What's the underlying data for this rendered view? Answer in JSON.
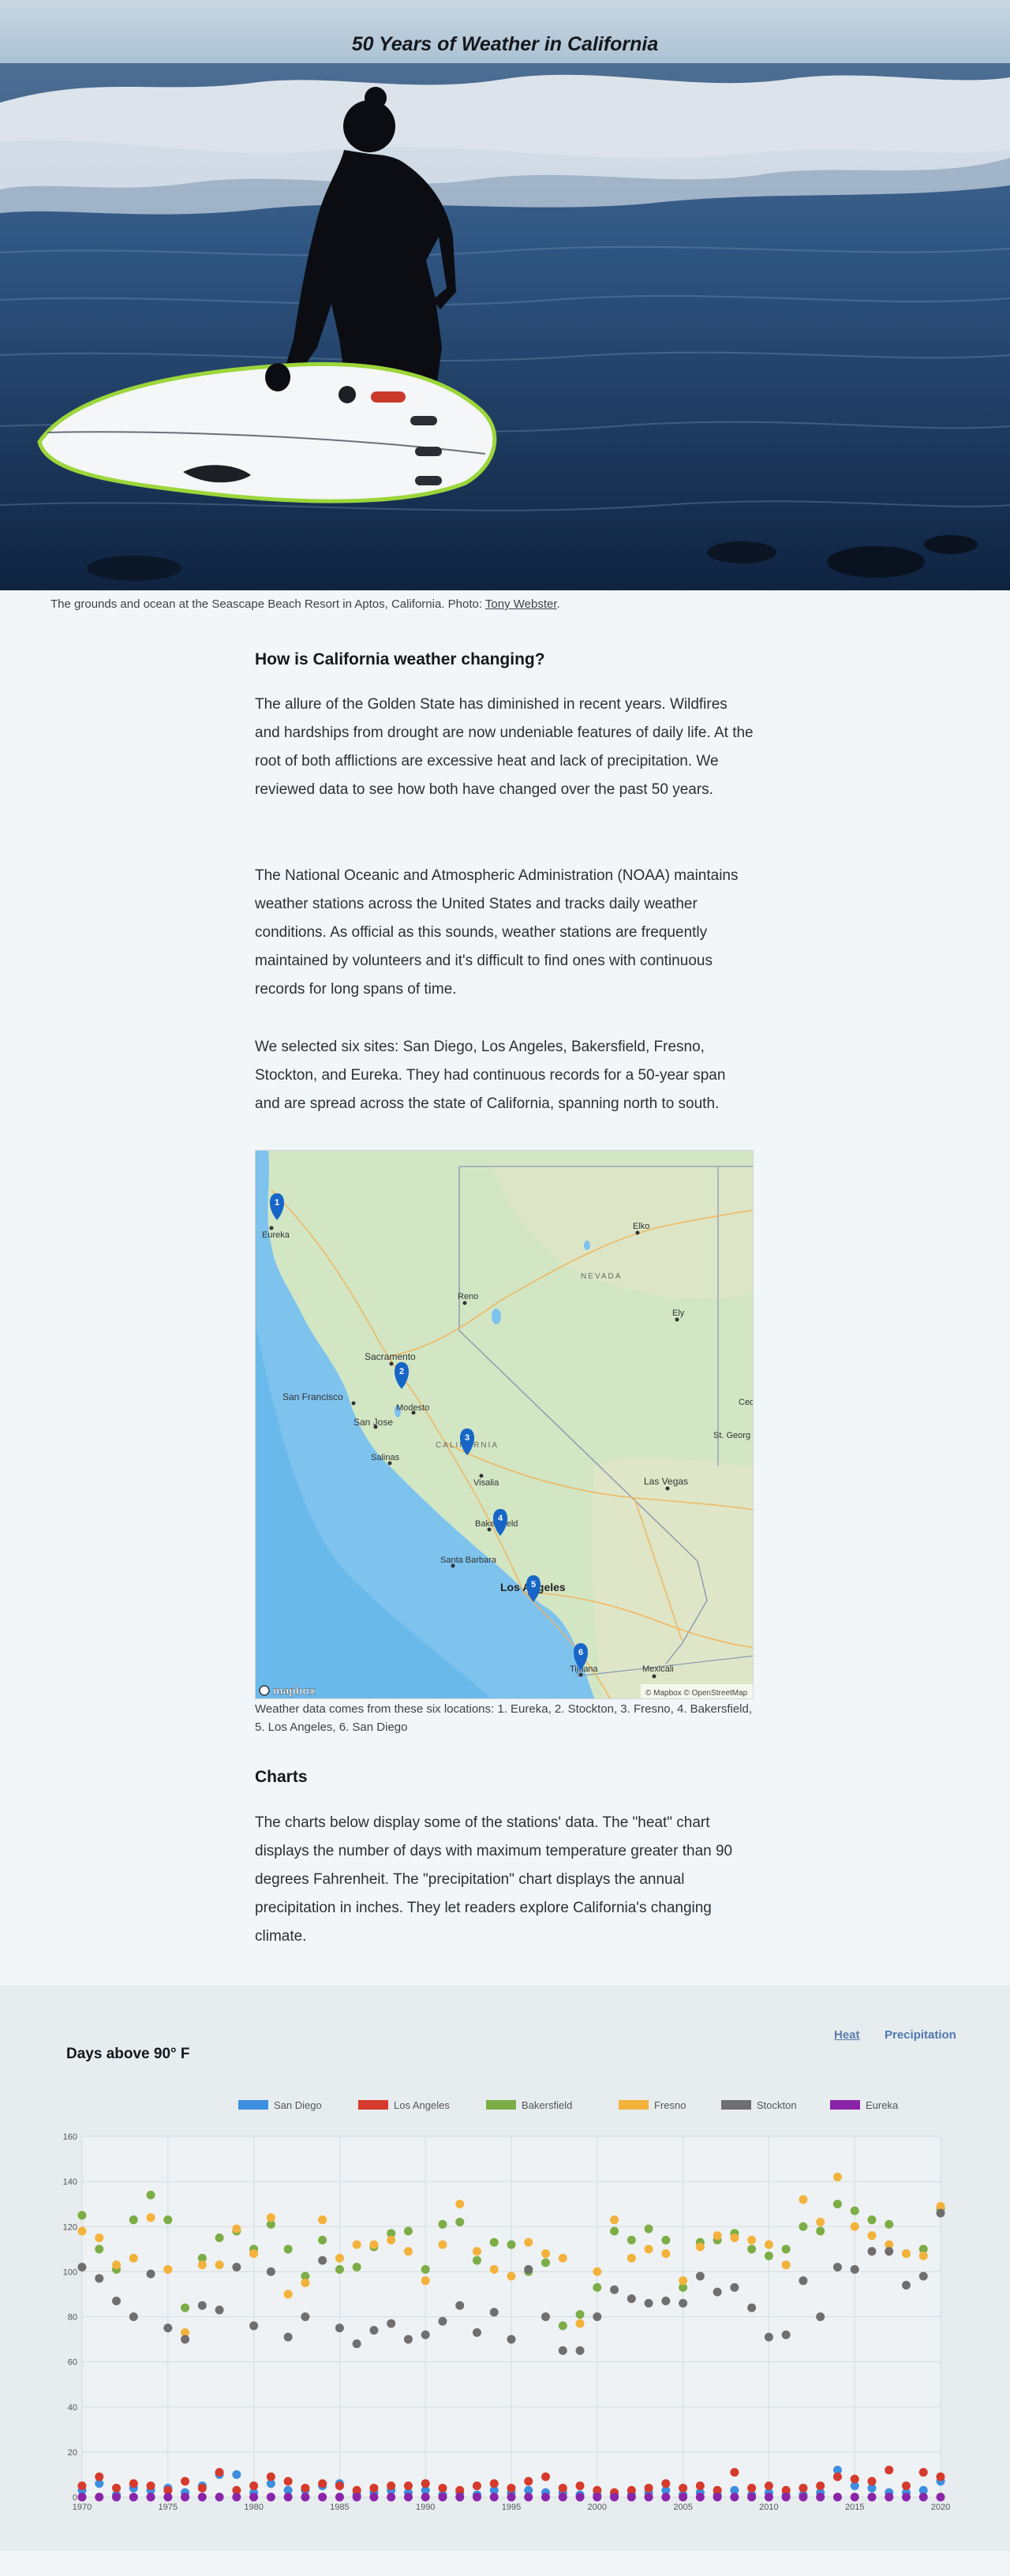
{
  "hero": {
    "title": "50 Years of Weather in California"
  },
  "photo_caption": {
    "text": "The grounds and ocean at the Seascape Beach Resort in Aptos, California. Photo: ",
    "credit": "Tony Webster",
    "end": "."
  },
  "section1": {
    "heading": "How is California weather changing?",
    "p1": "The allure of the Golden State has diminished in recent years. Wildfires and hardships from drought are now undeniable features of daily life. At the root of both afflictions are excessive heat and lack of precipitation. We reviewed data to see how both have changed over the past 50 years.",
    "p2": "The National Oceanic and Atmospheric Administration (NOAA) maintains weather stations across the United States and tracks daily weather conditions. As official as this sounds, weather stations are frequently maintained by volunteers and it's difficult to find ones with continuous records for long spans of time.",
    "p3": "We selected six sites: San Diego, Los Angeles, Bakersfield, Fresno, Stockton, and Eureka. They had continuous records for a 50-year span and are spread across the state of California, spanning north to south."
  },
  "map": {
    "labels": {
      "eureka": "Eureka",
      "elko": "Elko",
      "nevada": "NEVADA",
      "reno": "Reno",
      "ely": "Ely",
      "sacramento": "Sacramento",
      "san_francisco": "San Francisco",
      "modesto": "Modesto",
      "san_jose": "San Jose",
      "california": "CALIFORNIA",
      "ced": "Ced",
      "st_george": "St. Georg",
      "salinas": "Salinas",
      "visalia": "Visalia",
      "las_vegas": "Las Vegas",
      "bakersfield": "Bakersfield",
      "santa_barbara": "Santa Barbara",
      "los_angeles": "Los Angeles",
      "tijuana": "Tijuana",
      "mexicali": "Mexicali"
    },
    "markers": [
      "1",
      "2",
      "3",
      "4",
      "5",
      "6"
    ],
    "logo": "mapbox",
    "attribution": "© Mapbox © OpenStreetMap",
    "note": "Weather data comes from these six locations: 1. Eureka, 2. Stockton, 3. Fresno, 4. Bakersfield, 5. Los Angeles, 6. San Diego"
  },
  "section2": {
    "heading": "Charts",
    "p1": "The charts below display some of the stations' data. The \"heat\" chart displays the number of days with maximum temperature greater than 90 degrees Fahrenheit. The \"precipitation\" chart displays the annual precipitation in inches. They let readers explore California's changing climate."
  },
  "chart_section": {
    "title": "Days above 90° F",
    "tabs": {
      "heat": "Heat",
      "precipitation": "Precipitation"
    }
  },
  "chart_data": {
    "type": "scatter",
    "title": "Days above 90° F",
    "legend_position": "top",
    "grid": true,
    "ylim": [
      0,
      160
    ],
    "yticks": [
      0,
      20,
      40,
      60,
      80,
      100,
      120,
      140,
      160
    ],
    "xlim": [
      1970,
      2020
    ],
    "xticks": [
      1970,
      1975,
      1980,
      1985,
      1990,
      1995,
      2000,
      2005,
      2010,
      2015,
      2020
    ],
    "x": [
      1970,
      1971,
      1972,
      1973,
      1974,
      1975,
      1976,
      1977,
      1978,
      1979,
      1980,
      1981,
      1982,
      1983,
      1984,
      1985,
      1986,
      1987,
      1988,
      1989,
      1990,
      1991,
      1992,
      1993,
      1994,
      1995,
      1996,
      1997,
      1998,
      1999,
      2000,
      2001,
      2002,
      2003,
      2004,
      2005,
      2006,
      2007,
      2008,
      2009,
      2010,
      2011,
      2012,
      2013,
      2014,
      2015,
      2016,
      2017,
      2018,
      2019,
      2020
    ],
    "series": [
      {
        "name": "San Diego",
        "color": "#3d8fe0",
        "values": [
          3,
          6,
          1,
          4,
          3,
          4,
          2,
          5,
          10,
          10,
          2,
          6,
          3,
          3,
          5,
          6,
          1,
          2,
          3,
          2,
          3,
          1,
          2,
          1,
          3,
          2,
          3,
          2,
          2,
          1,
          1,
          1,
          1,
          2,
          3,
          1,
          2,
          1,
          3,
          1,
          2,
          1,
          1,
          2,
          12,
          5,
          4,
          2,
          2,
          3,
          7
        ]
      },
      {
        "name": "Los Angeles",
        "color": "#d63a2c",
        "values": [
          5,
          9,
          4,
          6,
          5,
          3,
          7,
          4,
          11,
          3,
          5,
          9,
          7,
          4,
          6,
          5,
          3,
          4,
          5,
          5,
          6,
          4,
          3,
          5,
          6,
          4,
          7,
          9,
          4,
          5,
          3,
          2,
          3,
          4,
          6,
          4,
          5,
          3,
          11,
          4,
          5,
          3,
          4,
          5,
          9,
          8,
          7,
          12,
          5,
          11,
          9
        ]
      },
      {
        "name": "Bakersfield",
        "color": "#7cad46",
        "values": [
          125,
          110,
          101,
          123,
          134,
          123,
          84,
          106,
          115,
          118,
          110,
          121,
          110,
          98,
          114,
          101,
          102,
          111,
          117,
          118,
          101,
          121,
          122,
          105,
          113,
          112,
          100,
          104,
          76,
          81,
          93,
          118,
          114,
          119,
          114,
          93,
          113,
          114,
          117,
          110,
          107,
          110,
          120,
          118,
          130,
          127,
          123,
          121,
          108,
          110,
          128
        ]
      },
      {
        "name": "Fresno",
        "color": "#f3b23b",
        "values": [
          118,
          115,
          103,
          106,
          124,
          101,
          73,
          103,
          103,
          119,
          108,
          124,
          90,
          95,
          123,
          106,
          112,
          112,
          114,
          109,
          96,
          112,
          130,
          109,
          101,
          98,
          113,
          108,
          106,
          77,
          100,
          123,
          106,
          110,
          108,
          96,
          111,
          116,
          115,
          114,
          112,
          103,
          132,
          122,
          142,
          120,
          116,
          112,
          108,
          107,
          129
        ]
      },
      {
        "name": "Stockton",
        "color": "#6f6f6f",
        "values": [
          102,
          97,
          87,
          80,
          99,
          75,
          70,
          85,
          83,
          102,
          76,
          100,
          71,
          80,
          105,
          75,
          68,
          74,
          77,
          70,
          72,
          78,
          85,
          73,
          82,
          70,
          101,
          80,
          65,
          65,
          80,
          92,
          88,
          86,
          87,
          86,
          98,
          91,
          93,
          84,
          71,
          72,
          96,
          80,
          102,
          101,
          109,
          109,
          94,
          98,
          126
        ]
      },
      {
        "name": "Eureka",
        "color": "#8a24a8",
        "values": [
          0,
          0,
          0,
          0,
          0,
          0,
          0,
          0,
          0,
          0,
          0,
          0,
          0,
          0,
          0,
          0,
          0,
          0,
          0,
          0,
          0,
          0,
          0,
          0,
          0,
          0,
          0,
          0,
          0,
          0,
          0,
          0,
          0,
          0,
          0,
          0,
          0,
          0,
          0,
          0,
          0,
          0,
          0,
          0,
          0,
          0,
          0,
          0,
          0,
          0,
          0
        ]
      }
    ]
  }
}
